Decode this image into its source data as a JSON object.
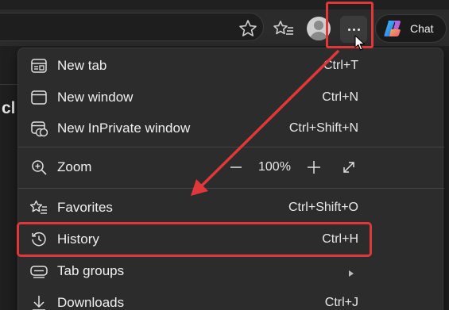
{
  "toolbar": {
    "star_icon": "star-add-icon",
    "favorites_icon": "favorites-icon",
    "more_icon": "more-horizontal-icon",
    "chat_label": "Chat"
  },
  "page": {
    "partial_text": "cl"
  },
  "menu": {
    "items": [
      {
        "label": "New tab",
        "shortcut": "Ctrl+T",
        "icon": "new-tab-icon"
      },
      {
        "label": "New window",
        "shortcut": "Ctrl+N",
        "icon": "new-window-icon"
      },
      {
        "label": "New InPrivate window",
        "shortcut": "Ctrl+Shift+N",
        "icon": "inprivate-icon"
      },
      {
        "label": "Zoom",
        "icon": "zoom-icon",
        "zoom_value": "100%",
        "minus": "—",
        "plus": "+"
      },
      {
        "label": "Favorites",
        "shortcut": "Ctrl+Shift+O",
        "icon": "favorites-icon"
      },
      {
        "label": "History",
        "shortcut": "Ctrl+H",
        "icon": "history-icon"
      },
      {
        "label": "Tab groups",
        "icon": "tab-groups-icon"
      },
      {
        "label": "Downloads",
        "shortcut": "Ctrl+J",
        "icon": "downloads-icon"
      }
    ]
  },
  "annotation_color": "#e0373b"
}
